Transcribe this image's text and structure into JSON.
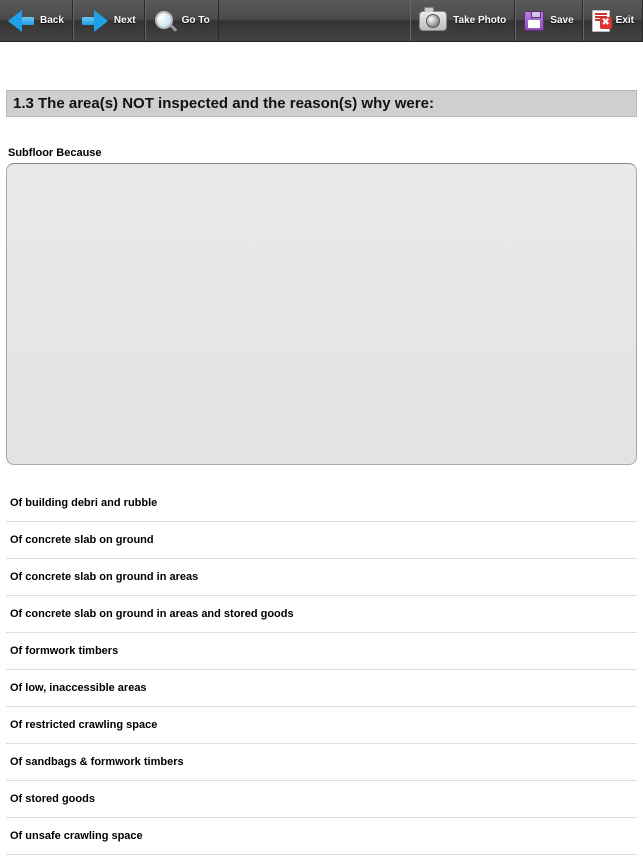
{
  "toolbar": {
    "back_label": "Back",
    "next_label": "Next",
    "goto_label": "Go To",
    "take_photo_label": "Take Photo",
    "save_label": "Save",
    "exit_label": "Exit"
  },
  "section": {
    "header": "1.3 The area(s) NOT inspected and the reason(s) why were:",
    "field_label": "Subfloor Because",
    "value": ""
  },
  "options": [
    "Of building debri and rubble",
    "Of concrete slab on ground",
    "Of concrete slab on ground in areas",
    "Of concrete slab on ground in areas and stored goods",
    "Of formwork timbers",
    "Of low, inaccessible areas",
    "Of restricted crawling space",
    "Of sandbags & formwork timbers",
    "Of stored goods",
    "Of unsafe crawling space"
  ]
}
